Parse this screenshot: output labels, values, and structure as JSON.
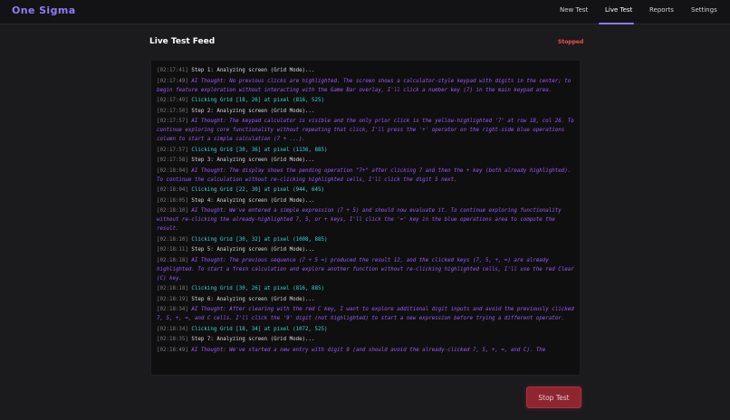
{
  "app": {
    "name": "One Sigma"
  },
  "nav": {
    "items": [
      {
        "label": "New Test",
        "active": false
      },
      {
        "label": "Live Test",
        "active": true
      },
      {
        "label": "Reports",
        "active": false
      },
      {
        "label": "Settings",
        "active": false
      }
    ]
  },
  "main": {
    "title": "Live Test Feed",
    "status": "Stopped",
    "stop_button_label": "Stop Test"
  },
  "colors": {
    "accent": "#8f7cf0",
    "status_stopped": "#ef5350",
    "thought_text": "#9a5cf0",
    "click_text": "#3ed0d0",
    "step_text": "#d6d6d6",
    "stop_button_bg": "#8e2530"
  },
  "log": [
    {
      "time": "[02:17:41]",
      "type": "step",
      "text": "Step 1: Analyzing screen (Grid Mode)..."
    },
    {
      "time": "[02:17:49]",
      "type": "thought",
      "text": "AI Thought: No previous clicks are highlighted. The screen shows a calculator-style keypad with digits in the center; to begin feature exploration without interacting with the Game Bar overlay, I'll click a number key (7) in the main keypad area."
    },
    {
      "time": "[02:17:49]",
      "type": "click",
      "text": "Clicking Grid [18, 26] at pixel (816, 525)"
    },
    {
      "time": "[02:17:50]",
      "type": "step",
      "text": "Step 2: Analyzing screen (Grid Mode)..."
    },
    {
      "time": "[02:17:57]",
      "type": "thought",
      "text": "AI Thought: The keypad calculator is visible and the only prior click is the yellow-highlighted '7' at row 18, col 26. To continue exploring core functionality without repeating that click, I'll press the '+' operator on the right-side blue operations column to start a simple calculation (7 + ...)."
    },
    {
      "time": "[02:17:57]",
      "type": "click",
      "text": "Clicking Grid [30, 36] at pixel (1136, 885)"
    },
    {
      "time": "[02:17:58]",
      "type": "step",
      "text": "Step 3: Analyzing screen (Grid Mode)..."
    },
    {
      "time": "[02:18:04]",
      "type": "thought",
      "text": "AI Thought: The display shows the pending operation \"7+\" after clicking 7 and then the + key (both already highlighted). To continue the calculation without re-clicking highlighted cells, I'll click the digit 5 next."
    },
    {
      "time": "[02:18:04]",
      "type": "click",
      "text": "Clicking Grid [22, 30] at pixel (944, 645)"
    },
    {
      "time": "[02:18:05]",
      "type": "step",
      "text": "Step 4: Analyzing screen (Grid Mode)..."
    },
    {
      "time": "[02:18:10]",
      "type": "thought",
      "text": "AI Thought: We've entered a simple expression (7 + 5) and should now evaluate it. To continue exploring functionality without re-clicking the already-highlighted 7, 5, or + keys, I'll click the '=' key in the blue operations area to compute the result."
    },
    {
      "time": "[02:18:10]",
      "type": "click",
      "text": "Clicking Grid [30, 32] at pixel (1008, 885)"
    },
    {
      "time": "[02:18:11]",
      "type": "step",
      "text": "Step 5: Analyzing screen (Grid Mode)..."
    },
    {
      "time": "[02:18:18]",
      "type": "thought",
      "text": "AI Thought: The previous sequence (7 + 5 =) produced the result 12, and the clicked keys (7, 5, +, =) are already highlighted. To start a fresh calculation and explore another function without re-clicking highlighted cells, I'll use the red Clear (C) key."
    },
    {
      "time": "[02:18:18]",
      "type": "click",
      "text": "Clicking Grid [30, 26] at pixel (816, 885)"
    },
    {
      "time": "[02:18:19]",
      "type": "step",
      "text": "Step 6: Analyzing screen (Grid Mode)..."
    },
    {
      "time": "[02:18:34]",
      "type": "thought",
      "text": "AI Thought: After clearing with the red C key, I want to explore additional digit inputs and avoid the previously clicked 7, 5, +, =, and C cells. I'll click the '9' digit (not highlighted) to start a new expression before trying a different operator."
    },
    {
      "time": "[02:18:34]",
      "type": "click",
      "text": "Clicking Grid [18, 34] at pixel (1072, 525)"
    },
    {
      "time": "[02:18:35]",
      "type": "step",
      "text": "Step 7: Analyzing screen (Grid Mode)..."
    },
    {
      "time": "[02:18:49]",
      "type": "thought",
      "text": "AI Thought: We've started a new entry with digit 9 (and should avoid the already-clicked 7, 5, +, =, and C). The"
    }
  ]
}
